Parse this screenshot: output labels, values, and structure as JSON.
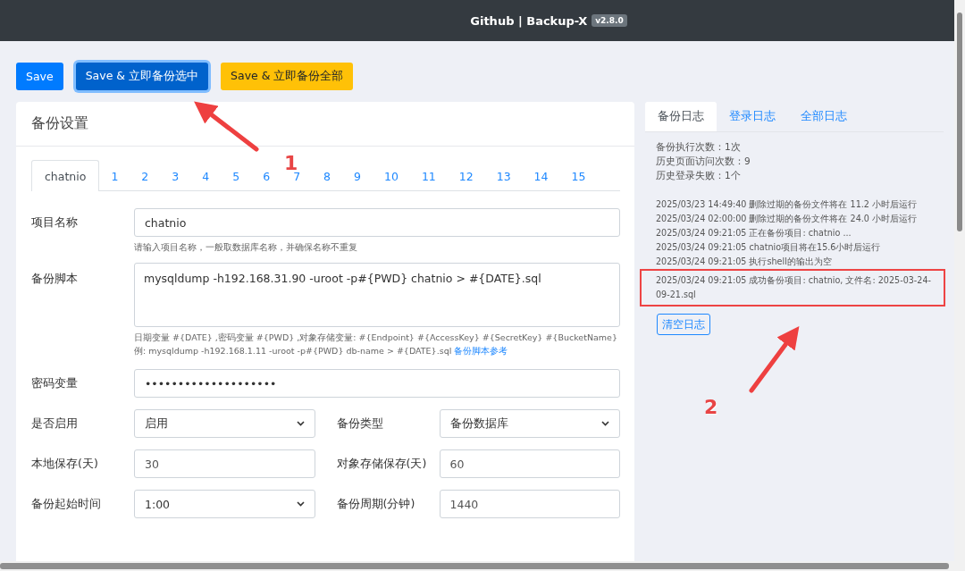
{
  "navbar": {
    "title": "Github | Backup-X",
    "version": "v2.8.0"
  },
  "actions": [
    {
      "label": "Save",
      "kind": "primary"
    },
    {
      "label": "Save & 立即备份选中",
      "kind": "focused"
    },
    {
      "label": "Save & 立即备份全部",
      "kind": "warning"
    }
  ],
  "settings": {
    "title": "备份设置",
    "tabs": [
      {
        "label": "chatnio",
        "selected": true
      },
      {
        "label": "1",
        "selected": false
      },
      {
        "label": "2",
        "selected": false
      },
      {
        "label": "3",
        "selected": false
      },
      {
        "label": "4",
        "selected": false
      },
      {
        "label": "5",
        "selected": false
      },
      {
        "label": "6",
        "selected": false
      },
      {
        "label": "7",
        "selected": false
      },
      {
        "label": "8",
        "selected": false
      },
      {
        "label": "9",
        "selected": false
      },
      {
        "label": "10",
        "selected": false
      },
      {
        "label": "11",
        "selected": false
      },
      {
        "label": "12",
        "selected": false
      },
      {
        "label": "13",
        "selected": false
      },
      {
        "label": "14",
        "selected": false
      },
      {
        "label": "15",
        "selected": false
      }
    ],
    "project_name": {
      "label": "项目名称",
      "value": "chatnio",
      "help": "请输入项目名称，一般取数据库名称，并确保名称不重复"
    },
    "script": {
      "label": "备份脚本",
      "value": "mysqldump -h192.168.31.90 -uroot -p#{PWD} chatnio > #{DATE}.sql",
      "help": "日期变量 #{DATE} ,密码变量 #{PWD} ,对象存储变量: #{Endpoint} #{AccessKey} #{SecretKey} #{BucketName}",
      "example": "例: mysqldump -h192.168.1.11 -uroot -p#{PWD} db-name > #{DATE}.sql",
      "link": "备份脚本参考"
    },
    "password": {
      "label": "密码变量",
      "value": "••••••••••••••••••••"
    },
    "pairs": [
      [
        {
          "label": "是否启用",
          "kind": "select",
          "value": "启用"
        },
        {
          "label": "备份类型",
          "kind": "select",
          "value": "备份数据库"
        }
      ],
      [
        {
          "label": "本地保存(天)",
          "kind": "input",
          "value": "30"
        },
        {
          "label": "对象存储保存(天)",
          "kind": "input",
          "value": "60"
        }
      ],
      [
        {
          "label": "备份起始时间",
          "kind": "select",
          "value": "1:00"
        },
        {
          "label": "备份周期(分钟)",
          "kind": "input",
          "value": "1440"
        }
      ]
    ]
  },
  "logs": {
    "tabs": [
      {
        "label": "备份日志",
        "selected": true
      },
      {
        "label": "登录日志",
        "selected": false
      },
      {
        "label": "全部日志",
        "selected": false
      }
    ],
    "stats": [
      "备份执行次数：1次",
      "历史页面访问次数：9",
      "历史登录失败：1个"
    ],
    "entries": [
      {
        "text": "2025/03/23 14:49:40 删除过期的备份文件将在 11.2 小时后运行",
        "highlighted": false
      },
      {
        "text": "2025/03/24 02:00:00 删除过期的备份文件将在 24.0 小时后运行",
        "highlighted": false
      },
      {
        "text": "2025/03/24 09:21:05 正在备份项目: chatnio ...",
        "highlighted": false
      },
      {
        "text": "2025/03/24 09:21:05 chatnio项目将在15.6小时后运行",
        "highlighted": false
      },
      {
        "text": "2025/03/24 09:21:05 执行shell的输出为空",
        "highlighted": false
      },
      {
        "text": "2025/03/24 09:21:05 成功备份项目: chatnio, 文件名: 2025-03-24-09-21.sql",
        "highlighted": true
      }
    ],
    "clear_button": "清空日志"
  },
  "annotations": [
    {
      "kind": "arrow",
      "label": "1"
    },
    {
      "kind": "arrow",
      "label": "2"
    }
  ]
}
